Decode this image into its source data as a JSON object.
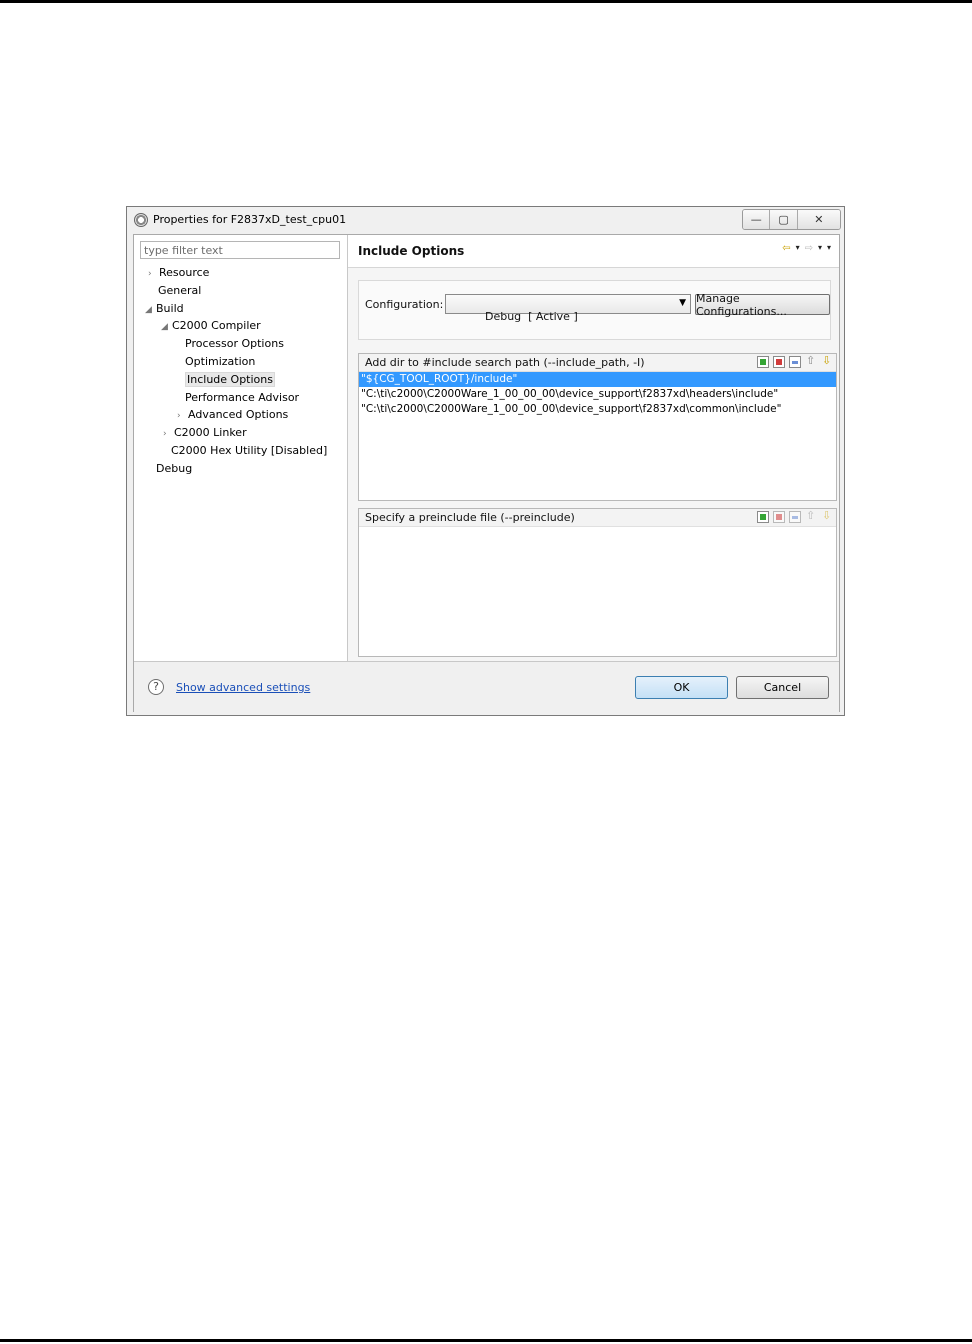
{
  "window": {
    "title": "Properties for F2837xD_test_cpu01",
    "controls": {
      "minimize": "—",
      "maximize": "▢",
      "close": "✕"
    }
  },
  "filter": {
    "placeholder": "type filter text"
  },
  "tree": [
    {
      "label": "Resource",
      "arrow": "›"
    },
    {
      "label": "General",
      "arrow": ""
    },
    {
      "label": "Build",
      "arrow": "◢"
    },
    {
      "label": "C2000 Compiler",
      "arrow": "◢"
    },
    {
      "label": "Processor Options",
      "arrow": ""
    },
    {
      "label": "Optimization",
      "arrow": ""
    },
    {
      "label": "Include Options",
      "arrow": "",
      "selected": true
    },
    {
      "label": "Performance Advisor",
      "arrow": ""
    },
    {
      "label": "Advanced Options",
      "arrow": "›"
    },
    {
      "label": "C2000 Linker",
      "arrow": "›"
    },
    {
      "label": "C2000 Hex Utility  [Disabled]",
      "arrow": ""
    },
    {
      "label": "Debug",
      "arrow": ""
    }
  ],
  "page": {
    "title": "Include Options",
    "nav": {
      "back": "⇦",
      "forward": "⇨",
      "menu": "▾"
    }
  },
  "configuration": {
    "label": "Configuration:",
    "selected": "Debug  [ Active ]",
    "manage_label": "Manage Configurations..."
  },
  "include_paths": {
    "header": "Add dir to #include search path (--include_path, -I)",
    "items": [
      "\"${CG_TOOL_ROOT}/include\"",
      "\"C:\\ti\\c2000\\C2000Ware_1_00_00_00\\device_support\\f2837xd\\headers\\include\"",
      "\"C:\\ti\\c2000\\C2000Ware_1_00_00_00\\device_support\\f2837xd\\common\\include\""
    ],
    "selected_index": 0
  },
  "preinclude": {
    "header": "Specify a preinclude file (--preinclude)",
    "items": []
  },
  "footer": {
    "help": "?",
    "advanced_link": "Show advanced settings",
    "ok_label": "OK",
    "cancel_label": "Cancel"
  },
  "colors": {
    "selection": "#3399ff",
    "link": "#1a4fb8",
    "ok_border": "#3c7fb1"
  }
}
